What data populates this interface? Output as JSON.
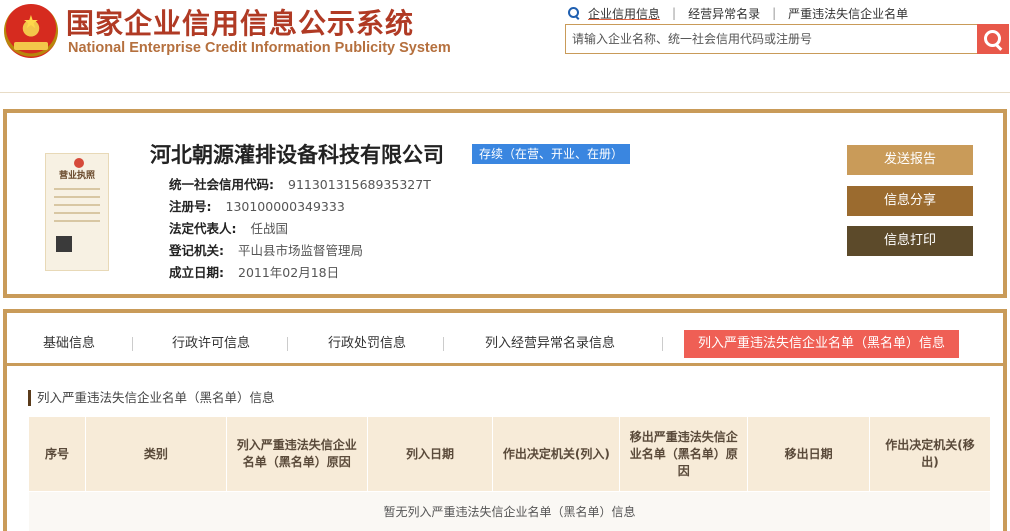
{
  "header": {
    "title_cn": "国家企业信用信息公示系统",
    "title_en": "National Enterprise Credit Information Publicity System",
    "links": [
      "企业信用信息",
      "经营异常名录",
      "严重违法失信企业名单"
    ],
    "search_placeholder": "请输入企业名称、统一社会信用代码或注册号"
  },
  "license": {
    "title": "营业执照"
  },
  "company": {
    "name": "河北朝源灌排设备科技有限公司",
    "status": "存续（在营、开业、在册）",
    "fields": [
      {
        "label": "统一社会信用代码:",
        "value": "91130131568935327T"
      },
      {
        "label": "注册号:",
        "value": "130100000349333"
      },
      {
        "label": "法定代表人:",
        "value": "任战国"
      },
      {
        "label": "登记机关:",
        "value": "平山县市场监督管理局"
      },
      {
        "label": "成立日期:",
        "value": "2011年02月18日"
      }
    ]
  },
  "actions": {
    "report": "发送报告",
    "share": "信息分享",
    "print": "信息打印"
  },
  "tabs": [
    "基础信息",
    "行政许可信息",
    "行政处罚信息",
    "列入经营异常名录信息",
    "列入严重违法失信企业名单（黑名单）信息"
  ],
  "section": {
    "title": "列入严重违法失信企业名单（黑名单）信息",
    "columns": [
      "序号",
      "类别",
      "列入严重违法失信企业名单（黑名单）原因",
      "列入日期",
      "作出决定机关(列入)",
      "移出严重违法失信企业名单（黑名单）原因",
      "移出日期",
      "作出决定机关(移出)"
    ],
    "empty_message": "暂无列入严重违法失信企业名单（黑名单）信息"
  },
  "colors": {
    "accent": "#c99b59",
    "title_red": "#b03a24",
    "active_tab": "#ef5f55",
    "status_blue": "#3a86e0"
  }
}
